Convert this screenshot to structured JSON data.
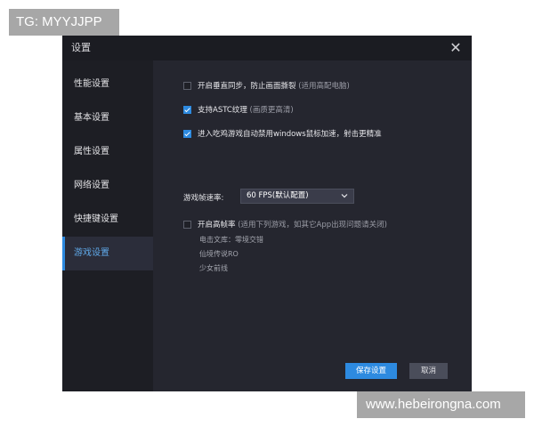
{
  "watermarks": {
    "top": "TG: MYYJJPP",
    "bottom": "www.hebeirongna.com"
  },
  "window": {
    "title": "设置"
  },
  "sidebar": {
    "items": [
      {
        "label": "性能设置"
      },
      {
        "label": "基本设置"
      },
      {
        "label": "属性设置"
      },
      {
        "label": "网络设置"
      },
      {
        "label": "快捷键设置"
      },
      {
        "label": "游戏设置",
        "active": true
      }
    ]
  },
  "options": {
    "vsync": {
      "label": "开启垂直同步，防止画面撕裂",
      "hint": "(适用高配电脑)",
      "checked": false
    },
    "astc": {
      "label": "支持ASTC纹理",
      "hint": "(画质更高清)",
      "checked": true
    },
    "mouse_accel": {
      "label": "进入吃鸡游戏自动禁用windows鼠标加速，射击更精准",
      "checked": true
    },
    "high_fps": {
      "label": "开启高帧率",
      "hint": "(适用下列游戏，如其它App出现问题请关闭)",
      "checked": false
    }
  },
  "fps": {
    "label": "游戏帧速率:",
    "selected": "60 FPS(默认配置)"
  },
  "games": [
    "电击文库：零境交错",
    "仙境传说RO",
    "少女前线"
  ],
  "buttons": {
    "save": "保存设置",
    "cancel": "取消"
  },
  "colors": {
    "accent": "#2d8ae0",
    "window_bg": "#25262f",
    "sidebar_bg": "#1d1e24"
  }
}
